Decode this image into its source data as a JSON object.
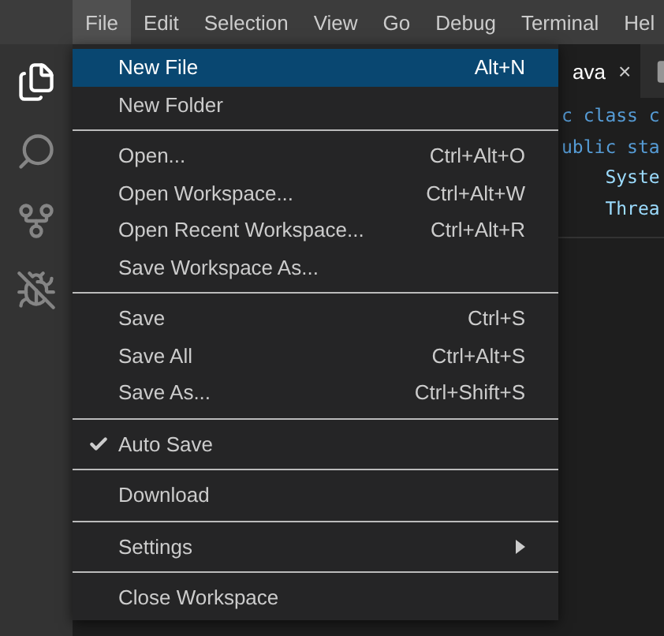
{
  "menubar": [
    {
      "label": "File",
      "selected": true
    },
    {
      "label": "Edit",
      "selected": false
    },
    {
      "label": "Selection",
      "selected": false
    },
    {
      "label": "View",
      "selected": false
    },
    {
      "label": "Go",
      "selected": false
    },
    {
      "label": "Debug",
      "selected": false
    },
    {
      "label": "Terminal",
      "selected": false
    },
    {
      "label": "Hel",
      "selected": false
    }
  ],
  "activity_bar": [
    {
      "kind": "files",
      "selected": true
    },
    {
      "kind": "search",
      "selected": false
    },
    {
      "kind": "source-control",
      "selected": false
    },
    {
      "kind": "debug",
      "selected": false
    }
  ],
  "editor": {
    "tabs": [
      {
        "label": "ava",
        "close": "×",
        "selected": true
      },
      {
        "kind": "file",
        "selected": false
      }
    ],
    "code": [
      {
        "text": "c class c",
        "kind": "keyword"
      },
      {
        "text": "ublic sta",
        "kind": "keyword"
      },
      {
        "text": "    Syste",
        "kind": "identifier"
      },
      {
        "text": "    Threa",
        "kind": "identifier"
      }
    ]
  },
  "file_menu": [
    [
      {
        "label": "New File",
        "shortcut": "Alt+N",
        "selected": true,
        "checked": false
      },
      {
        "label": "New Folder",
        "selected": false,
        "checked": false
      }
    ],
    [
      {
        "label": "Open...",
        "shortcut": "Ctrl+Alt+O",
        "selected": false,
        "checked": false
      },
      {
        "label": "Open Workspace...",
        "shortcut": "Ctrl+Alt+W",
        "selected": false,
        "checked": false
      },
      {
        "label": "Open Recent Workspace...",
        "shortcut": "Ctrl+Alt+R",
        "selected": false,
        "checked": false
      },
      {
        "label": "Save Workspace As...",
        "selected": false,
        "checked": false
      }
    ],
    [
      {
        "label": "Save",
        "shortcut": "Ctrl+S",
        "selected": false,
        "checked": false
      },
      {
        "label": "Save All",
        "shortcut": "Ctrl+Alt+S",
        "selected": false,
        "checked": false
      },
      {
        "label": "Save As...",
        "shortcut": "Ctrl+Shift+S",
        "selected": false,
        "checked": false
      }
    ],
    [
      {
        "label": "Auto Save",
        "selected": false,
        "checked": true
      }
    ],
    [
      {
        "label": "Download",
        "selected": false,
        "checked": false
      }
    ],
    [
      {
        "label": "Settings",
        "selected": false,
        "checked": false,
        "submenu": true
      }
    ],
    [
      {
        "label": "Close Workspace",
        "selected": false,
        "checked": false
      }
    ]
  ]
}
